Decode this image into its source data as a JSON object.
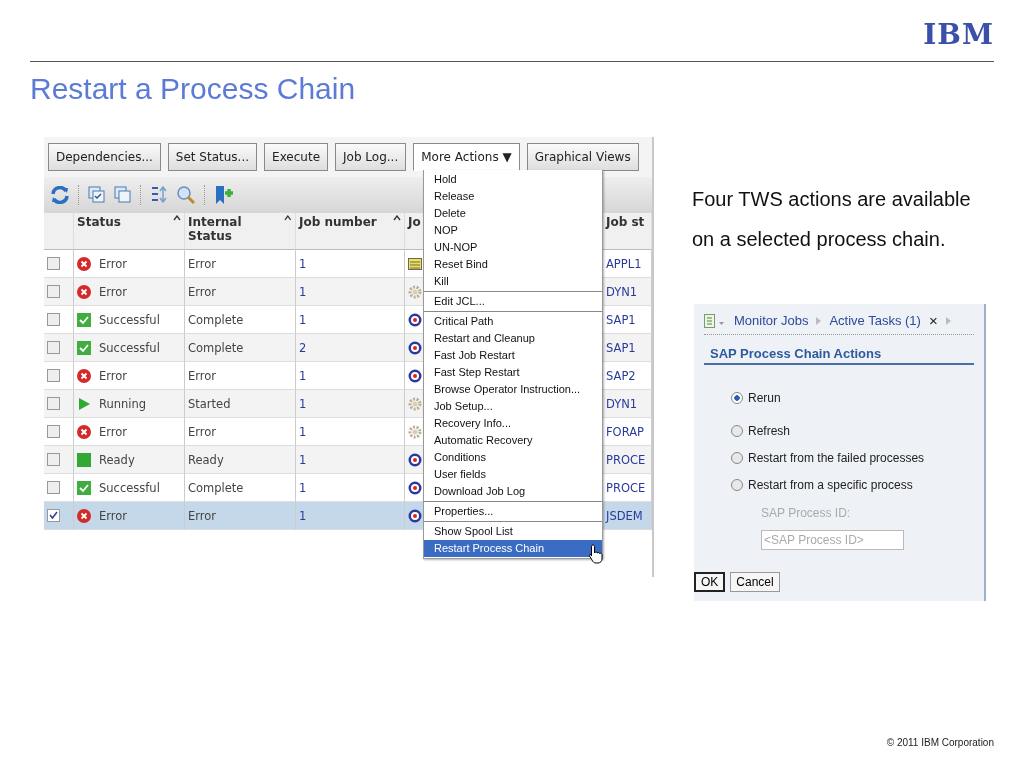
{
  "logo": "IBM",
  "title": "Restart a Process Chain",
  "screenshot": {
    "buttons": [
      {
        "label": "Dependencies...",
        "open": false
      },
      {
        "label": "Set Status...",
        "open": false
      },
      {
        "label": "Execute",
        "open": false
      },
      {
        "label": "Job Log...",
        "open": false
      },
      {
        "label": "More Actions ▼",
        "open": true
      },
      {
        "label": "Graphical Views",
        "open": false
      }
    ],
    "columns": [
      {
        "label": "Status",
        "sorted": true
      },
      {
        "label": "Internal Status",
        "sorted": true
      },
      {
        "label": "Job number",
        "sorted": true
      },
      {
        "label": "Jo"
      },
      {
        "label": "Job st",
        "sorted": false
      }
    ],
    "rows": [
      {
        "checked": false,
        "selected": false,
        "status": {
          "kind": "error",
          "text": "Error"
        },
        "internal_status": "Error",
        "job_number": "1",
        "job": {
          "kind": "document"
        },
        "job_stream": "APPL1"
      },
      {
        "checked": false,
        "selected": false,
        "status": {
          "kind": "error",
          "text": "Error"
        },
        "internal_status": "Error",
        "job_number": "1",
        "job": {
          "kind": "gear"
        },
        "job_stream": "DYN1"
      },
      {
        "checked": false,
        "selected": false,
        "status": {
          "kind": "success",
          "text": "Successful"
        },
        "internal_status": "Complete",
        "job_number": "1",
        "job": {
          "kind": "target"
        },
        "job_stream": "SAP1"
      },
      {
        "checked": false,
        "selected": false,
        "status": {
          "kind": "success",
          "text": "Successful"
        },
        "internal_status": "Complete",
        "job_number": "2",
        "job": {
          "kind": "target"
        },
        "job_stream": "SAP1"
      },
      {
        "checked": false,
        "selected": false,
        "status": {
          "kind": "error",
          "text": "Error"
        },
        "internal_status": "Error",
        "job_number": "1",
        "job": {
          "kind": "target"
        },
        "job_stream": "SAP2"
      },
      {
        "checked": false,
        "selected": false,
        "status": {
          "kind": "running",
          "text": "Running"
        },
        "internal_status": "Started",
        "job_number": "1",
        "job": {
          "kind": "gear"
        },
        "job_stream": "DYN1"
      },
      {
        "checked": false,
        "selected": false,
        "status": {
          "kind": "error",
          "text": "Error"
        },
        "internal_status": "Error",
        "job_number": "1",
        "job": {
          "kind": "gear"
        },
        "job_stream": "FORAP"
      },
      {
        "checked": false,
        "selected": false,
        "status": {
          "kind": "ready",
          "text": "Ready"
        },
        "internal_status": "Ready",
        "job_number": "1",
        "job": {
          "kind": "target"
        },
        "job_stream": "PROCE"
      },
      {
        "checked": false,
        "selected": false,
        "status": {
          "kind": "success",
          "text": "Successful"
        },
        "internal_status": "Complete",
        "job_number": "1",
        "job": {
          "kind": "target"
        },
        "job_stream": "PROCE"
      },
      {
        "checked": true,
        "selected": true,
        "status": {
          "kind": "error",
          "text": "Error"
        },
        "internal_status": "Error",
        "job_number": "1",
        "job": {
          "kind": "target"
        },
        "job_stream": "JSDEM"
      }
    ],
    "menu": [
      [
        {
          "label": "Hold",
          "selected": false
        },
        {
          "label": "Release",
          "selected": false
        },
        {
          "label": "Delete",
          "selected": false
        },
        {
          "label": "NOP",
          "selected": false
        },
        {
          "label": "UN-NOP",
          "selected": false
        },
        {
          "label": "Reset Bind",
          "selected": false
        },
        {
          "label": "Kill",
          "selected": false
        }
      ],
      [
        {
          "label": "Edit JCL...",
          "selected": false
        }
      ],
      [
        {
          "label": "Critical Path",
          "selected": false
        },
        {
          "label": "Restart and Cleanup",
          "selected": false
        },
        {
          "label": "Fast Job Restart",
          "selected": false
        },
        {
          "label": "Fast Step Restart",
          "selected": false
        },
        {
          "label": "Browse Operator Instruction...",
          "selected": false
        },
        {
          "label": "Job Setup...",
          "selected": false
        },
        {
          "label": "Recovery Info...",
          "selected": false
        },
        {
          "label": "Automatic Recovery",
          "selected": false
        },
        {
          "label": "Conditions",
          "selected": false
        },
        {
          "label": "User fields",
          "selected": false
        },
        {
          "label": "Download Job Log",
          "selected": false
        }
      ],
      [
        {
          "label": "Properties...",
          "selected": false
        }
      ],
      [
        {
          "label": "Show Spool List",
          "selected": false
        },
        {
          "label": "Restart Process Chain",
          "selected": true
        }
      ]
    ]
  },
  "note": [
    "Four TWS actions are available",
    "on a selected process chain."
  ],
  "dialog": {
    "breadcrumbs": [
      "Monitor Jobs",
      "Active Tasks (1)"
    ],
    "close": "×",
    "heading": "SAP Process Chain Actions",
    "options": [
      {
        "label": "Rerun",
        "selected": true
      },
      {
        "label": "Refresh",
        "selected": false
      },
      {
        "label": "Restart from the failed processes",
        "selected": false
      },
      {
        "label": "Restart from a specific process",
        "selected": false
      }
    ],
    "field": {
      "label": "SAP Process ID:",
      "placeholder": "<SAP Process ID>",
      "disabled": true
    },
    "buttons": [
      {
        "label": "OK",
        "focused": true
      },
      {
        "label": "Cancel",
        "focused": false
      }
    ]
  },
  "footer": "© 2011 IBM Corporation"
}
